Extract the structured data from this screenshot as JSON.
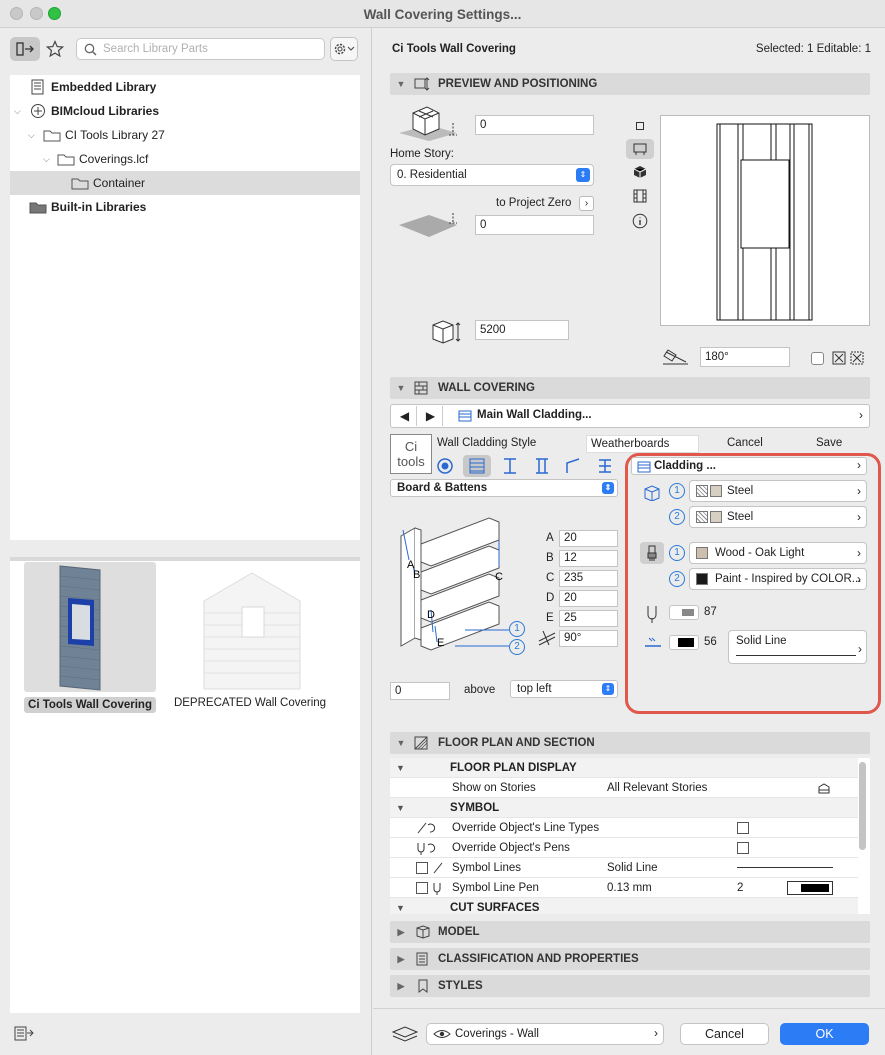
{
  "window": {
    "title": "Wall Covering Settings..."
  },
  "left": {
    "search_placeholder": "Search Library Parts",
    "tree": [
      {
        "label": "Embedded Library",
        "bold": true
      },
      {
        "label": "BIMcloud Libraries",
        "bold": true
      },
      {
        "label": "CI Tools Library 27",
        "bold": false
      },
      {
        "label": "Coverings.lcf",
        "bold": false
      },
      {
        "label": "Container",
        "bold": false
      },
      {
        "label": "Built-in Libraries",
        "bold": true
      }
    ],
    "thumbs": [
      {
        "label": "Ci Tools Wall Covering"
      },
      {
        "label": "DEPRECATED Wall Covering"
      }
    ]
  },
  "header": {
    "object_name": "Ci Tools Wall Covering",
    "selection": "Selected: 1 Editable: 1"
  },
  "preview": {
    "section_title": "PREVIEW AND POSITIONING",
    "offset_value": "0",
    "home_story_label": "Home Story:",
    "home_story_value": "0. Residential",
    "to_project_zero": "to Project Zero",
    "zero_value": "0",
    "height_value": "5200",
    "angle_value": "180°"
  },
  "covering": {
    "section_title": "WALL COVERING",
    "nav_label": "Main Wall Cladding...",
    "style_label": "Wall Cladding Style",
    "style_value": "Weatherboards",
    "cancel": "Cancel",
    "save": "Save",
    "logo_line1": "Ci",
    "logo_line2": "tools",
    "type_value": "Board & Battens",
    "dims": [
      {
        "letter": "A",
        "value": "20"
      },
      {
        "letter": "B",
        "value": "12"
      },
      {
        "letter": "C",
        "value": "235"
      },
      {
        "letter": "D",
        "value": "20"
      },
      {
        "letter": "E",
        "value": "25"
      }
    ],
    "angle_value": "90°",
    "above_value": "0",
    "above_label": "above",
    "anchor_value": "top left",
    "cladding_title": "Cladding ...",
    "mat1": "Steel",
    "mat2": "Steel",
    "surf1": "Wood - Oak Light",
    "surf2": "Paint - Inspired by COLOR...",
    "surf1_color": "#cdbfae",
    "surf2_color": "#1a1a1a",
    "pen1": "87",
    "pen2": "56",
    "line_type": "Solid Line",
    "num1": "1",
    "num2": "2"
  },
  "floorplan": {
    "section_title": "FLOOR PLAN AND SECTION",
    "fp_display": "FLOOR PLAN DISPLAY",
    "show_on_stories": "Show on Stories",
    "show_value": "All Relevant Stories",
    "symbol": "SYMBOL",
    "override_lines": "Override Object's Line Types",
    "override_pens": "Override Object's Pens",
    "symbol_lines": "Symbol Lines",
    "symbol_lines_value": "Solid Line",
    "symbol_pen": "Symbol Line Pen",
    "symbol_pen_value": "0.13 mm",
    "symbol_pen_num": "2",
    "cut_surfaces": "CUT SURFACES"
  },
  "sections": {
    "model": "MODEL",
    "classification": "CLASSIFICATION AND PROPERTIES",
    "styles": "STYLES"
  },
  "footer": {
    "layer": "Coverings - Wall",
    "cancel": "Cancel",
    "ok": "OK"
  },
  "colors": {
    "accent": "#2c7cf6",
    "highlight": "#e0574b"
  }
}
